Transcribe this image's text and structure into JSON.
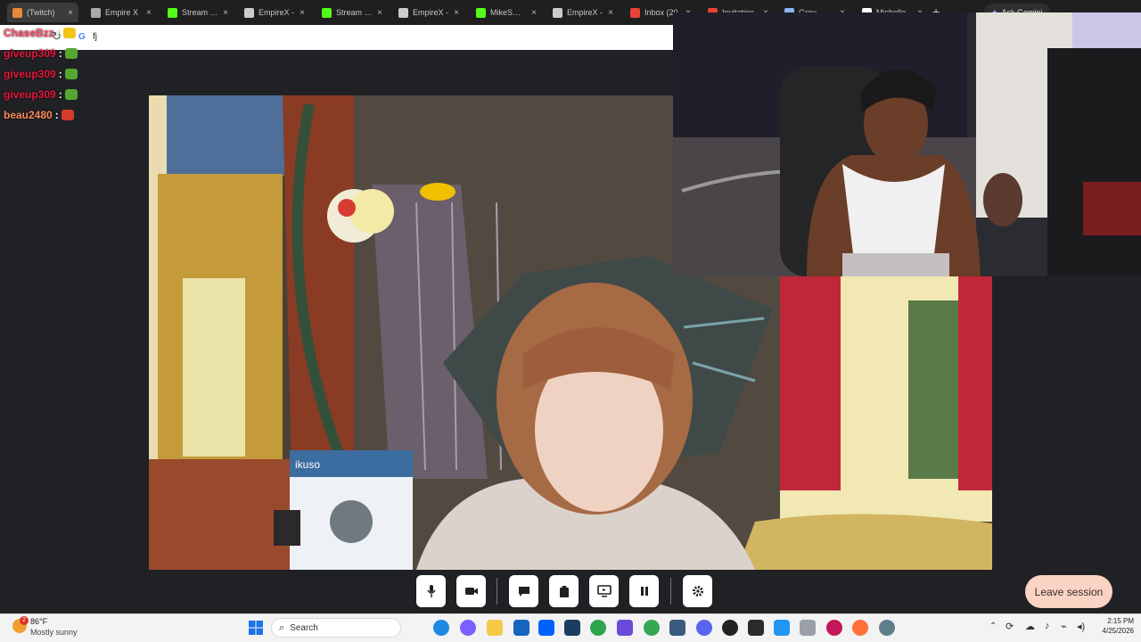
{
  "browser": {
    "tabs": [
      {
        "label": "(Twitch)",
        "fav_color": "#e9883a"
      },
      {
        "label": "Empire X",
        "fav_color": "#aaaaaa"
      },
      {
        "label": "Stream - K",
        "fav_color": "#53fc18"
      },
      {
        "label": "EmpireX -",
        "fav_color": "#cccccc"
      },
      {
        "label": "Stream - K",
        "fav_color": "#53fc18"
      },
      {
        "label": "EmpireX -",
        "fav_color": "#cccccc"
      },
      {
        "label": "MikeSmalli",
        "fav_color": "#53fc18"
      },
      {
        "label": "EmpireX -",
        "fav_color": "#cccccc"
      },
      {
        "label": "Inbox (20",
        "fav_color": "#ea4335"
      },
      {
        "label": "Invitation",
        "fav_color": "#ea4335"
      },
      {
        "label": "Grou",
        "fav_color": "#8ab4f8"
      },
      {
        "label": "Michelle",
        "fav_color": "#ffffff"
      }
    ],
    "ask_gemini": "Ask Gemini",
    "address_text": "fj",
    "address_engine": "G"
  },
  "chat": [
    {
      "user": "ChaseBzz",
      "color": "#ff4d6d",
      "emote": "#f0c419"
    },
    {
      "user": "giveup309",
      "color": "#e8173c",
      "emote": "#55a630"
    },
    {
      "user": "giveup309",
      "color": "#e8173c",
      "emote": "#55a630"
    },
    {
      "user": "giveup309",
      "color": "#e8173c",
      "emote": "#55a630"
    },
    {
      "user": "beau2480",
      "color": "#ff8c5a",
      "emote": "#d63b2e"
    }
  ],
  "video": {
    "box_label": "ikuso"
  },
  "controls": {
    "leave_label": "Leave session",
    "buttons": [
      "microphone-icon",
      "camera-icon",
      "chat-icon",
      "clipboard-icon",
      "present-screen-icon",
      "pause-icon",
      "settings-icon"
    ]
  },
  "taskbar": {
    "weather_temp": "86°F",
    "weather_desc": "Mostly sunny",
    "weather_badge": "2",
    "search_label": "Search",
    "time": "2:15 PM",
    "date": "4/25/2026"
  }
}
